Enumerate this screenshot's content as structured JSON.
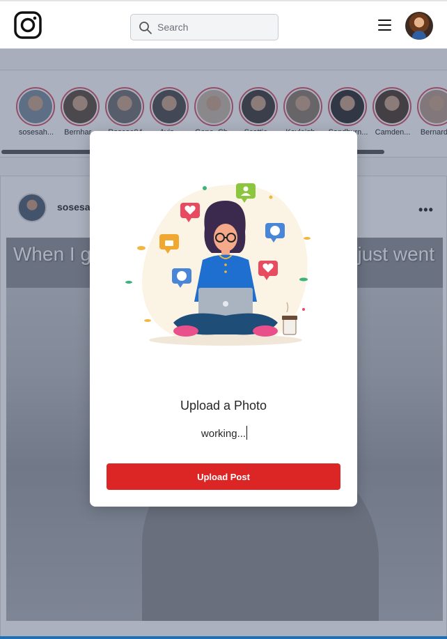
{
  "header": {
    "logo_icon": "instagram-icon",
    "search": {
      "placeholder": "Search",
      "value": "",
      "icon": "search-icon"
    },
    "menu_icon": "hamburger-menu-icon",
    "profile_avatar": "user-avatar"
  },
  "stories": [
    {
      "name": "sosesah...",
      "color": "#7b8c9e"
    },
    {
      "name": "Bernhar...",
      "color": "#5a4a3e"
    },
    {
      "name": "Roscoe94",
      "color": "#6e6e6e"
    },
    {
      "name": "Avis...",
      "color": "#4a4a4a"
    },
    {
      "name": "Gene_Ch...",
      "color": "#c8b8a8"
    },
    {
      "name": "Scottie...",
      "color": "#3e3a3a"
    },
    {
      "name": "Kayleigh...",
      "color": "#8c7c6c"
    },
    {
      "name": "Sandburn...",
      "color": "#2e2e2e"
    },
    {
      "name": "Camden...",
      "color": "#4c3c30"
    },
    {
      "name": "Bernard...",
      "color": "#b89c8c"
    }
  ],
  "post": {
    "username": "sosesa",
    "more_icon": "more-options-icon",
    "caption_left": "When I g",
    "caption_right": "just went"
  },
  "modal": {
    "title": "Upload a Photo",
    "caption_value": "working...",
    "upload_button": "Upload Post",
    "illustration": "woman-with-laptop-social-media-illustration"
  },
  "colors": {
    "accent_red": "#dc2626",
    "story_ring": "#d6536a",
    "overlay": "rgba(55,70,100,0.42)"
  }
}
